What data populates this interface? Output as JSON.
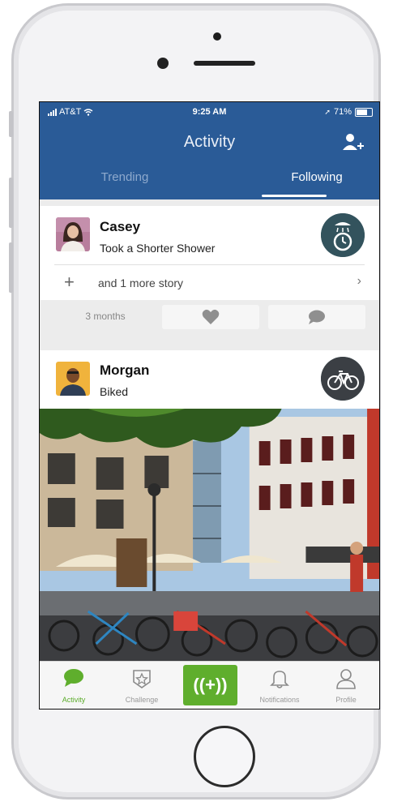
{
  "status_bar": {
    "carrier": "AT&T",
    "time": "9:25 AM",
    "battery": "71%"
  },
  "header": {
    "title": "Activity",
    "tabs": [
      {
        "label": "Trending",
        "active": false
      },
      {
        "label": "Following",
        "active": true
      }
    ],
    "add_user_icon": "add-user-icon"
  },
  "feed": [
    {
      "name": "Casey",
      "action": "Took a Shorter Shower",
      "badge_icon": "shower-timer-icon",
      "more_label": "and 1 more story",
      "time_ago": "3 months"
    },
    {
      "name": "Morgan",
      "action": "Biked",
      "badge_icon": "bicycle-icon"
    }
  ],
  "tab_bar": [
    {
      "label": "Activity",
      "icon": "chat-bubble-icon",
      "active": true
    },
    {
      "label": "Challenge",
      "icon": "star-badge-icon",
      "active": false
    },
    {
      "label": "((+))",
      "icon": "broadcast-plus-icon",
      "active": false
    },
    {
      "label": "Notifications",
      "icon": "bell-icon",
      "active": false
    },
    {
      "label": "Profile",
      "icon": "person-icon",
      "active": false
    }
  ],
  "colors": {
    "header": "#2a5b97",
    "accent_green": "#5fae2d",
    "badge": "#33535d"
  }
}
